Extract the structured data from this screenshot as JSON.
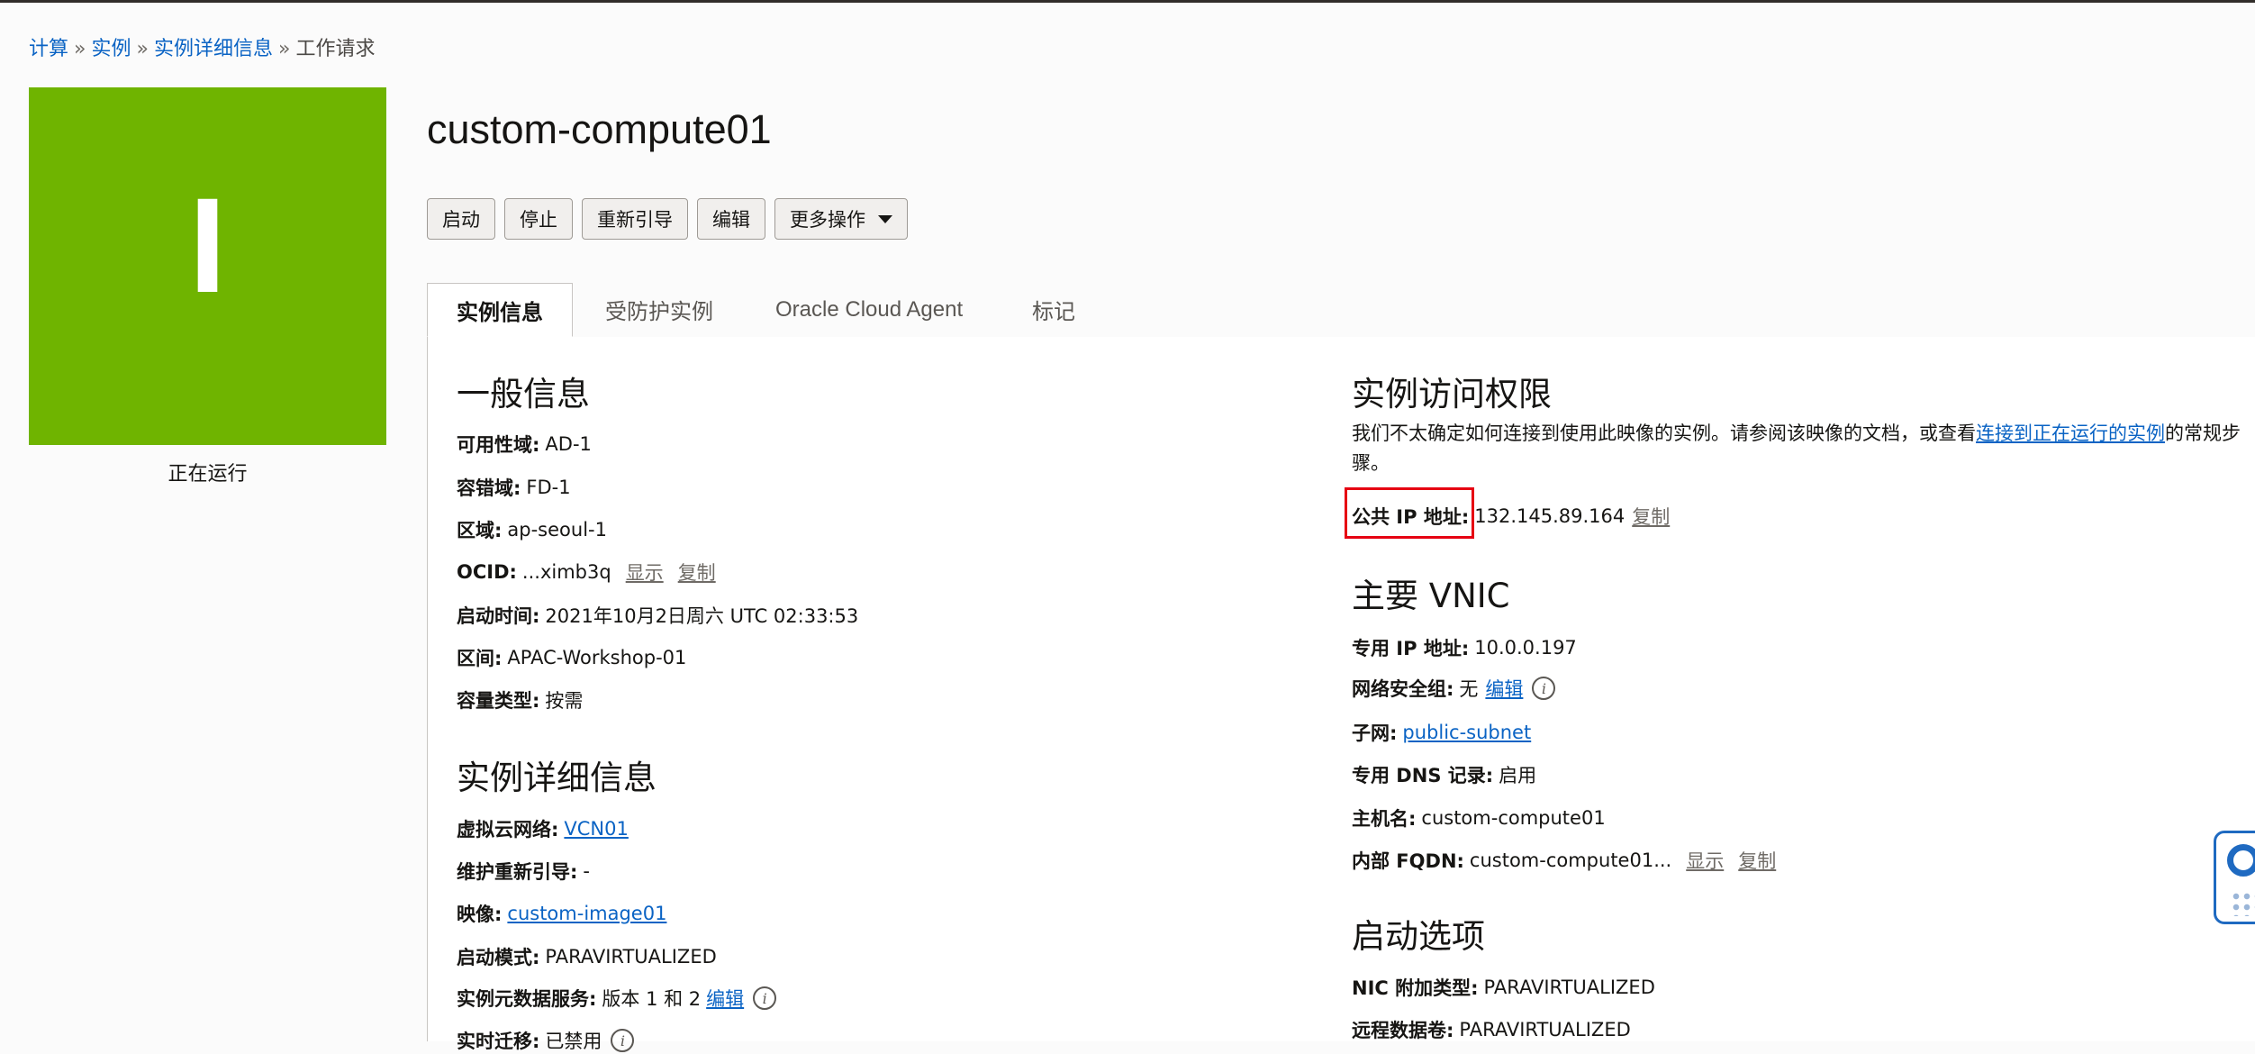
{
  "breadcrumb": {
    "items": [
      "计算",
      "实例",
      "实例详细信息"
    ],
    "current": "工作请求",
    "separator": "»"
  },
  "instance": {
    "tile_letter": "I",
    "tile_color": "#6fb400",
    "state": "正在运行",
    "title": "custom-compute01"
  },
  "actions": {
    "start": "启动",
    "stop": "停止",
    "reboot": "重新引导",
    "edit": "编辑",
    "more": "更多操作"
  },
  "tabs": [
    "实例信息",
    "受防护实例",
    "Oracle Cloud Agent",
    "标记"
  ],
  "general": {
    "heading": "一般信息",
    "availability_domain": {
      "label": "可用性域:",
      "value": "AD-1"
    },
    "fault_domain": {
      "label": "容错域:",
      "value": "FD-1"
    },
    "region": {
      "label": "区域:",
      "value": "ap-seoul-1"
    },
    "ocid": {
      "label": "OCID:",
      "value": "...ximb3q",
      "show": "显示",
      "copy": "复制"
    },
    "launched": {
      "label": "启动时间:",
      "value": "2021年10月2日周六 UTC 02:33:53"
    },
    "compartment": {
      "label": "区间:",
      "value": "APAC-Workshop-01"
    },
    "capacity_type": {
      "label": "容量类型:",
      "value": "按需"
    }
  },
  "details": {
    "heading": "实例详细信息",
    "vcn": {
      "label": "虚拟云网络:",
      "value": "VCN01"
    },
    "maintenance_reboot": {
      "label": "维护重新引导:",
      "value": "-"
    },
    "image": {
      "label": "映像:",
      "value": "custom-image01"
    },
    "launch_mode": {
      "label": "启动模式:",
      "value": "PARAVIRTUALIZED"
    },
    "metadata_service": {
      "label": "实例元数据服务:",
      "value": "版本 1 和 2",
      "edit": "编辑"
    },
    "live_migration": {
      "label": "实时迁移:",
      "value": "已禁用"
    }
  },
  "access": {
    "heading": "实例访问权限",
    "text_before": "我们不太确定如何连接到使用此映像的实例。请参阅该映像的文档，或查看",
    "link": "连接到正在运行的实例",
    "text_after": "的常规步骤。",
    "public_ip": {
      "label": "公共 IP 地址:",
      "value": "132.145.89.164",
      "copy": "复制"
    }
  },
  "vnic": {
    "heading": "主要 VNIC",
    "private_ip": {
      "label": "专用 IP 地址:",
      "value": "10.0.0.197"
    },
    "nsg": {
      "label": "网络安全组:",
      "value": "无",
      "edit": "编辑"
    },
    "subnet": {
      "label": "子网:",
      "value": "public-subnet"
    },
    "dns_record": {
      "label": "专用 DNS 记录:",
      "value": "启用"
    },
    "hostname": {
      "label": "主机名:",
      "value": "custom-compute01"
    },
    "fqdn": {
      "label": "内部 FQDN:",
      "value": "custom-compute01...",
      "show": "显示",
      "copy": "复制"
    }
  },
  "launch_options": {
    "heading": "启动选项",
    "nic_type": {
      "label": "NIC 附加类型:",
      "value": "PARAVIRTUALIZED"
    },
    "remote_volume": {
      "label": "远程数据卷:",
      "value": "PARAVIRTUALIZED"
    }
  },
  "colors": {
    "link": "#0a63c4",
    "highlight_box": "#e60012",
    "tile": "#6fb400"
  }
}
